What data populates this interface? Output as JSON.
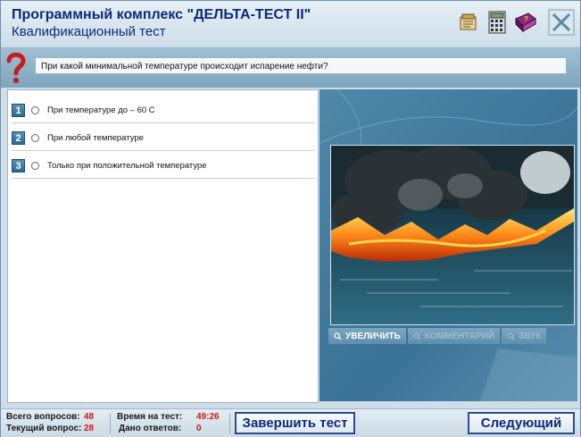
{
  "header": {
    "title": "Программный комплекс \"ДЕЛЬТА-ТЕСТ II\"",
    "subtitle": "Квалификационный тест"
  },
  "question": {
    "text": "При какой минимальной температуре происходит испарение нефти?"
  },
  "answers": [
    {
      "number": "1",
      "text": "При температуре до – 60 С"
    },
    {
      "number": "2",
      "text": "При любой температуре"
    },
    {
      "number": "3",
      "text": "Только при положительной температуре"
    }
  ],
  "media": {
    "zoom_label": "УВЕЛИЧИТЬ",
    "comment_label": "КОММЕНТАРИЙ",
    "sound_label": "ЗВУК"
  },
  "status": {
    "total_questions_label": "Всего вопросов:",
    "total_questions": "48",
    "current_question_label": "Текущий вопрос:",
    "current_question": "28",
    "test_time_label": "Время на тест:",
    "test_time": "49:26",
    "answers_given_label": "Дано ответов:",
    "answers_given": "0",
    "finish_label": "Завершить тест",
    "next_label": "Следующий"
  },
  "colors": {
    "title_blue": "#0b2b7a",
    "value_red": "#d01818",
    "question_mark": "#c91d1d"
  },
  "icons": [
    "notepad-icon",
    "calculator-icon",
    "help-book-icon",
    "close-icon",
    "question-mark-icon"
  ]
}
